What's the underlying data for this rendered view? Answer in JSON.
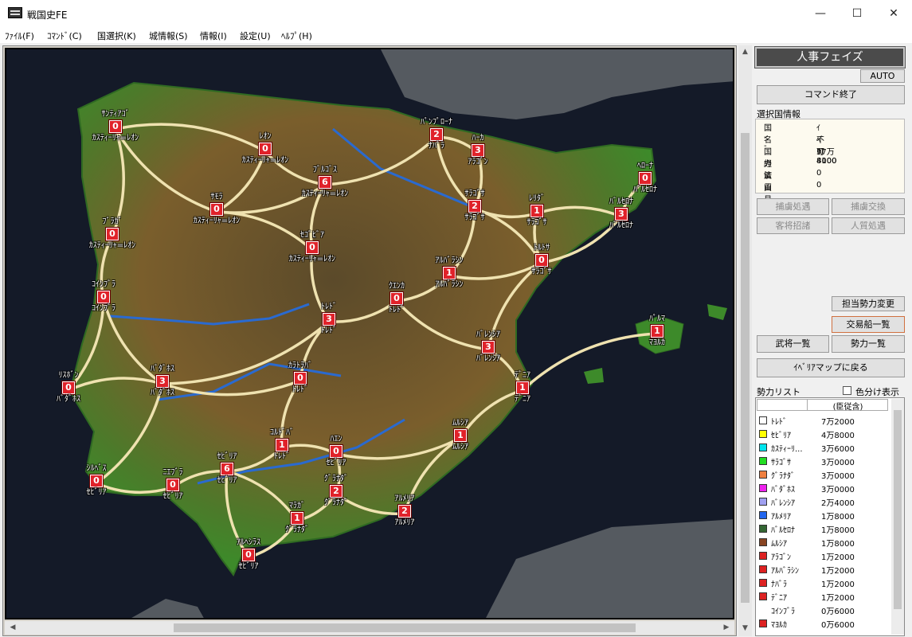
{
  "window": {
    "title": "戦国史FE",
    "minimize": "—",
    "maximize": "☐",
    "close": "✕"
  },
  "menu": [
    "ﾌｧｲﾙ(F)",
    "ｺﾏﾝﾄﾞ(C)",
    "国選択(K)",
    "城情報(S)",
    "情報(I)",
    "設定(U)",
    "ﾍﾙﾌﾟ(H)"
  ],
  "panel": {
    "phase": "人事フェイズ",
    "auto": "AUTO",
    "end_command": "コマンド終了",
    "info_label": "選択国情報",
    "info": [
      {
        "k": "国名",
        "v": "ｲﾍﾞﾘｱ"
      },
      {
        "k": "--",
        "v": "不可"
      },
      {
        "k": "国力",
        "v": "37万8000"
      },
      {
        "k": "経済",
        "v": "4100"
      },
      {
        "k": "鉱山",
        "v": "0"
      },
      {
        "k": "貿易港",
        "v": "0"
      }
    ],
    "btn_prisoner_treat": "捕虜処遇",
    "btn_prisoner_exchange": "捕虜交換",
    "btn_guest": "客将招諸",
    "btn_hostage": "人質処遇",
    "btn_change_force": "担当勢力変更",
    "btn_trade_ships": "交易船一覧",
    "btn_generals": "武将一覧",
    "btn_forces": "勢力一覧",
    "btn_back_map": "ｲﾍﾞﾘｱマップに戻る",
    "list_label": "勢力リスト",
    "color_split": "色分け表示",
    "list_header": "(臣従含)",
    "forces": [
      {
        "name": "ﾄﾚﾄﾞ",
        "count": "7万2000",
        "color": "#ffffff"
      },
      {
        "name": "ｾﾋﾞﾘｱ",
        "count": "4万8000",
        "color": "#ffff00"
      },
      {
        "name": "ｶｽﾃｨｰﾘ...",
        "count": "3万6000",
        "color": "#00e5ee"
      },
      {
        "name": "ｻﾗｺﾞｻ",
        "count": "3万0000",
        "color": "#22dd22"
      },
      {
        "name": "ｸﾞﾗﾅﾀﾞ",
        "count": "3万0000",
        "color": "#f08040"
      },
      {
        "name": "ﾊﾞﾀﾞﾎｽ",
        "count": "3万0000",
        "color": "#ee22ee"
      },
      {
        "name": "ﾊﾞﾚﾝｼｱ",
        "count": "2万4000",
        "color": "#a0a0f0"
      },
      {
        "name": "ｱﾙﾒﾘｱ",
        "count": "1万8000",
        "color": "#2266ee"
      },
      {
        "name": "ﾊﾞﾙｾﾛﾅ",
        "count": "1万8000",
        "color": "#336633"
      },
      {
        "name": "ﾑﾙｼｱ",
        "count": "1万8000",
        "color": "#884422"
      },
      {
        "name": "ｱﾗｺﾞﾝ",
        "count": "1万2000",
        "color": "#dd2222"
      },
      {
        "name": "ｱﾙﾊﾞﾗｼﾝ",
        "count": "1万2000",
        "color": "#dd2222"
      },
      {
        "name": "ﾅﾊﾞﾗ",
        "count": "1万2000",
        "color": "#dd2222"
      },
      {
        "name": "ﾃﾞﾆｱ",
        "count": "1万2000",
        "color": "#dd2222"
      },
      {
        "name": "ｺｲﾝﾌﾞﾗ",
        "count": "0万6000",
        "color": ""
      },
      {
        "name": "ﾏﾖﾙｶ",
        "count": "0万6000",
        "color": "#dd2222"
      }
    ]
  },
  "map": {
    "cities": [
      {
        "name": "ｻﾝﾃｨｱｺﾞ",
        "n": "0",
        "owner": "ｶｽﾃｨｰﾘｬ=ﾚｵﾝ"
      },
      {
        "name": "ﾚｵﾝ",
        "n": "0",
        "owner": "ｶｽﾃｨｰﾘｬ=ﾚｵﾝ"
      },
      {
        "name": "ﾌﾞﾙｺﾞｽ",
        "n": "6",
        "owner": "ｶｽﾃｨｰﾘｬ=ﾚｵﾝ"
      },
      {
        "name": "ﾊﾟﾝﾌﾟﾛｰﾅ",
        "n": "2",
        "owner": "ﾅﾊﾞﾗ"
      },
      {
        "name": "ﾊｰｶ",
        "n": "3",
        "owner": "ｱﾗｺﾞﾝ"
      },
      {
        "name": "ﾍﾛｰﾅ",
        "n": "0",
        "owner": "ﾊﾞﾙｾﾛﾅ"
      },
      {
        "name": "ｻﾓﾗ",
        "n": "0",
        "owner": "ｶｽﾃｨｰﾘｬ=ﾚｵﾝ"
      },
      {
        "name": "ﾌﾞﾗｶﾞ",
        "n": "0",
        "owner": "ｶｽﾃｨｰﾘｬ=ﾚｵﾝ"
      },
      {
        "name": "ｾｺﾞﾋﾞｱ",
        "n": "0",
        "owner": "ｶｽﾃｨｰﾘｬ=ﾚｵﾝ"
      },
      {
        "name": "ｻﾗｺﾞｻ",
        "n": "2",
        "owner": "ｻﾗｺﾞｻ"
      },
      {
        "name": "ﾚﾘﾀﾞ",
        "n": "1",
        "owner": "ｻﾗｺﾞｻ"
      },
      {
        "name": "ﾊﾞﾙｾﾛﾅ",
        "n": "3",
        "owner": "ﾊﾞﾙｾﾛﾅ"
      },
      {
        "name": "ﾄﾙﾄｻ",
        "n": "0",
        "owner": "ｻﾗｺﾞｻ"
      },
      {
        "name": "ｱﾙﾊﾞﾗｼﾝ",
        "n": "1",
        "owner": "ｱﾙﾊﾞﾗｼﾝ"
      },
      {
        "name": "ｺｲﾝﾌﾞﾗ",
        "n": "0",
        "owner": "ｺｲﾝﾌﾞﾗ"
      },
      {
        "name": "ｸｴﾝｶ",
        "n": "0",
        "owner": "ﾄﾚﾄﾞ"
      },
      {
        "name": "ﾄﾚﾄﾞ",
        "n": "3",
        "owner": "ﾄﾚﾄﾞ"
      },
      {
        "name": "ﾊﾟﾙﾏ",
        "n": "1",
        "owner": "ﾏﾖﾙｶ"
      },
      {
        "name": "ﾊﾞﾚﾝｼｱ",
        "n": "3",
        "owner": "ﾊﾞﾚﾝｼｱ"
      },
      {
        "name": "ﾘｽﾎﾞﾝ",
        "n": "0",
        "owner": "ﾊﾞﾀﾞﾎｽ"
      },
      {
        "name": "ﾊﾞﾀﾞﾎｽ",
        "n": "3",
        "owner": "ﾊﾞﾀﾞﾎｽ"
      },
      {
        "name": "ｶﾗﾄﾗﾊﾞ",
        "n": "0",
        "owner": "ﾄﾚﾄﾞ"
      },
      {
        "name": "ﾃﾞﾆｱ",
        "n": "1",
        "owner": "ﾃﾞﾆｱ"
      },
      {
        "name": "ｺﾙﾄﾞﾊﾞ",
        "n": "1",
        "owner": "ﾄﾚﾄﾞ"
      },
      {
        "name": "ﾊｴﾝ",
        "n": "0",
        "owner": "ｾﾋﾞﾘｱ"
      },
      {
        "name": "ﾑﾙｼｱ",
        "n": "1",
        "owner": "ﾑﾙｼｱ"
      },
      {
        "name": "ｼﾙﾍﾞｽ",
        "n": "0",
        "owner": "ｾﾋﾞﾘｱ"
      },
      {
        "name": "ﾆｴﾌﾞﾗ",
        "n": "0",
        "owner": "ｾﾋﾞﾘｱ"
      },
      {
        "name": "ｾﾋﾞﾘｱ",
        "n": "6",
        "owner": "ｾﾋﾞﾘｱ"
      },
      {
        "name": "ｸﾞﾗﾅﾀﾞ",
        "n": "2",
        "owner": "ｸﾞﾗﾅﾀﾞ"
      },
      {
        "name": "ｱﾙﾒﾘｱ",
        "n": "2",
        "owner": "ｱﾙﾒﾘｱ"
      },
      {
        "name": "ﾏﾗｶﾞ",
        "n": "1",
        "owner": "ｸﾞﾗﾅﾀﾞ"
      },
      {
        "name": "ｱﾙﾍｼﾗｽ",
        "n": "0",
        "owner": "ｾﾋﾞﾘｱ"
      }
    ],
    "roads": [
      [
        0,
        1
      ],
      [
        0,
        6
      ],
      [
        0,
        7
      ],
      [
        1,
        2
      ],
      [
        1,
        6
      ],
      [
        2,
        3
      ],
      [
        2,
        6
      ],
      [
        2,
        8
      ],
      [
        3,
        4
      ],
      [
        3,
        9
      ],
      [
        4,
        9
      ],
      [
        9,
        10
      ],
      [
        10,
        11
      ],
      [
        5,
        11
      ],
      [
        9,
        12
      ],
      [
        10,
        12
      ],
      [
        11,
        12
      ],
      [
        7,
        14
      ],
      [
        6,
        8
      ],
      [
        8,
        16
      ],
      [
        12,
        13
      ],
      [
        12,
        18
      ],
      [
        13,
        15
      ],
      [
        13,
        9
      ],
      [
        15,
        16
      ],
      [
        15,
        18
      ],
      [
        14,
        19
      ],
      [
        14,
        20
      ],
      [
        16,
        20
      ],
      [
        16,
        21
      ],
      [
        18,
        22
      ],
      [
        17,
        22
      ],
      [
        19,
        20
      ],
      [
        20,
        21
      ],
      [
        20,
        26
      ],
      [
        21,
        23
      ],
      [
        23,
        24
      ],
      [
        24,
        25
      ],
      [
        25,
        22
      ],
      [
        25,
        30
      ],
      [
        24,
        29
      ],
      [
        26,
        27
      ],
      [
        27,
        28
      ],
      [
        28,
        23
      ],
      [
        28,
        31
      ],
      [
        28,
        32
      ],
      [
        29,
        31
      ],
      [
        29,
        30
      ],
      [
        31,
        32
      ]
    ]
  }
}
